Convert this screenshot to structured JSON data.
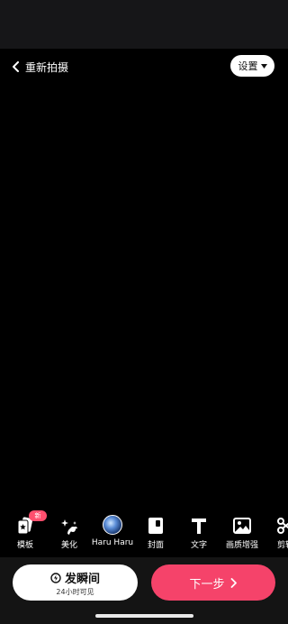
{
  "header": {
    "back_label": "重新拍摄",
    "settings_label": "设置"
  },
  "toolbar": {
    "items": [
      {
        "label": "模板",
        "icon": "template-cards-icon",
        "badge": "新"
      },
      {
        "label": "美化",
        "icon": "beautify-sparkle-icon"
      },
      {
        "label": "Haru Haru",
        "icon": "music-globe-icon"
      },
      {
        "label": "封面",
        "icon": "cover-icon"
      },
      {
        "label": "文字",
        "icon": "text-t-icon"
      },
      {
        "label": "画质增强",
        "icon": "image-enhance-icon"
      },
      {
        "label": "剪辑",
        "icon": "scissors-icon"
      }
    ]
  },
  "bottom": {
    "moment_label": "发瞬间",
    "moment_sub": "24小时可见",
    "next_label": "下一步"
  },
  "colors": {
    "accent": "#f5436a",
    "badge": "#ff4f6e",
    "background": "#000000",
    "bottom_bar": "#141414"
  }
}
